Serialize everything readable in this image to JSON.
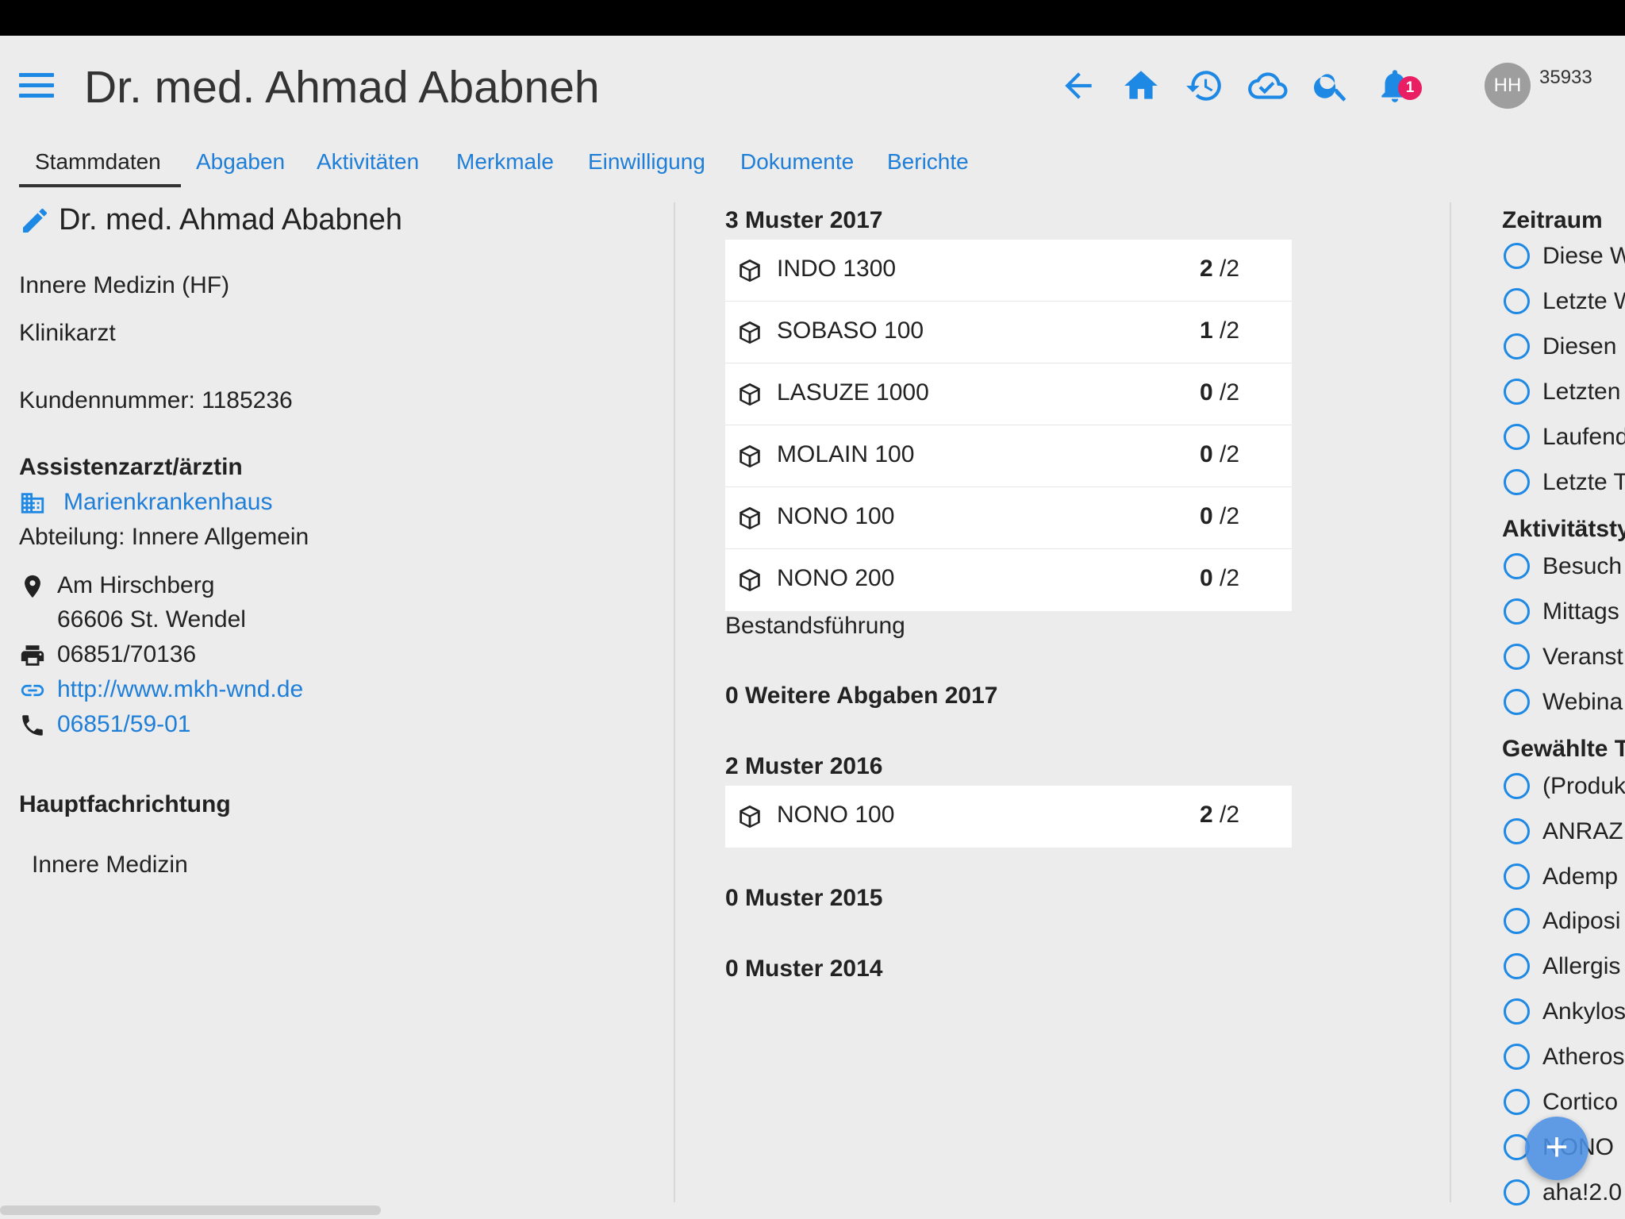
{
  "header": {
    "title": "Dr. med. Ahmad Ababneh",
    "notification_count": "1",
    "avatar_initials": "HH",
    "user_id": "35933"
  },
  "tabs": [
    {
      "label": "Stammdaten"
    },
    {
      "label": "Abgaben"
    },
    {
      "label": "Aktivitäten"
    },
    {
      "label": "Merkmale"
    },
    {
      "label": "Einwilligung"
    },
    {
      "label": "Dokumente"
    },
    {
      "label": "Berichte"
    }
  ],
  "profile": {
    "name": "Dr. med. Ahmad Ababneh",
    "specialty": "Innere Medizin (HF)",
    "role": "Klinikarzt",
    "customer_number": "Kundennummer: 1185236",
    "position": "Assistenzarzt/ärztin",
    "hospital": "Marienkrankenhaus",
    "department": "Abteilung: Innere Allgemein",
    "street": "Am Hirschberg",
    "city": "66606 St. Wendel",
    "fax": "06851/70136",
    "website": "http://www.mkh-wnd.de",
    "phone": "06851/59-01",
    "main_specialty_heading": "Hauptfachrichtung",
    "main_specialty": "Innere Medizin"
  },
  "samples": {
    "y2017_heading": "3 Muster 2017",
    "y2017": [
      {
        "name": "INDO 1300",
        "given": "2",
        "total": "/2"
      },
      {
        "name": "SOBASO 100",
        "given": "1",
        "total": "/2"
      },
      {
        "name": "LASUZE 1000",
        "given": "0",
        "total": "/2"
      },
      {
        "name": "MOLAIN 100",
        "given": "0",
        "total": "/2"
      },
      {
        "name": "NONO 100",
        "given": "0",
        "total": "/2"
      },
      {
        "name": "NONO 200",
        "given": "0",
        "total": "/2"
      }
    ],
    "inventory_link": "Bestandsführung",
    "other_2017": "0 Weitere Abgaben 2017",
    "y2016_heading": "2 Muster 2016",
    "y2016": [
      {
        "name": "NONO 100",
        "given": "2",
        "total": "/2"
      }
    ],
    "y2015_heading": "0 Muster 2015",
    "y2014_heading": "0 Muster 2014"
  },
  "filters": {
    "zeitraum_heading": "Zeitraum",
    "zeitraum": [
      "Diese W",
      "Letzte W",
      "Diesen",
      "Letzten",
      "Laufend",
      "Letzte T"
    ],
    "aktivitaet_heading": "Aktivitätsty",
    "aktivitaet": [
      "Besuch",
      "Mittags",
      "Veranst",
      "Webina"
    ],
    "themen_heading": "Gewählte T",
    "themen": [
      "(Produk",
      "ANRAZ",
      "Ademp",
      "Adiposi",
      "Allergis",
      "Ankylos",
      "Atheros",
      "Cortico",
      "NONO",
      "aha!2.0"
    ]
  },
  "fab_label": "+",
  "colors": {
    "accent": "#1e88e5",
    "badge": "#e91e63",
    "avatar": "#9e9e9e"
  }
}
